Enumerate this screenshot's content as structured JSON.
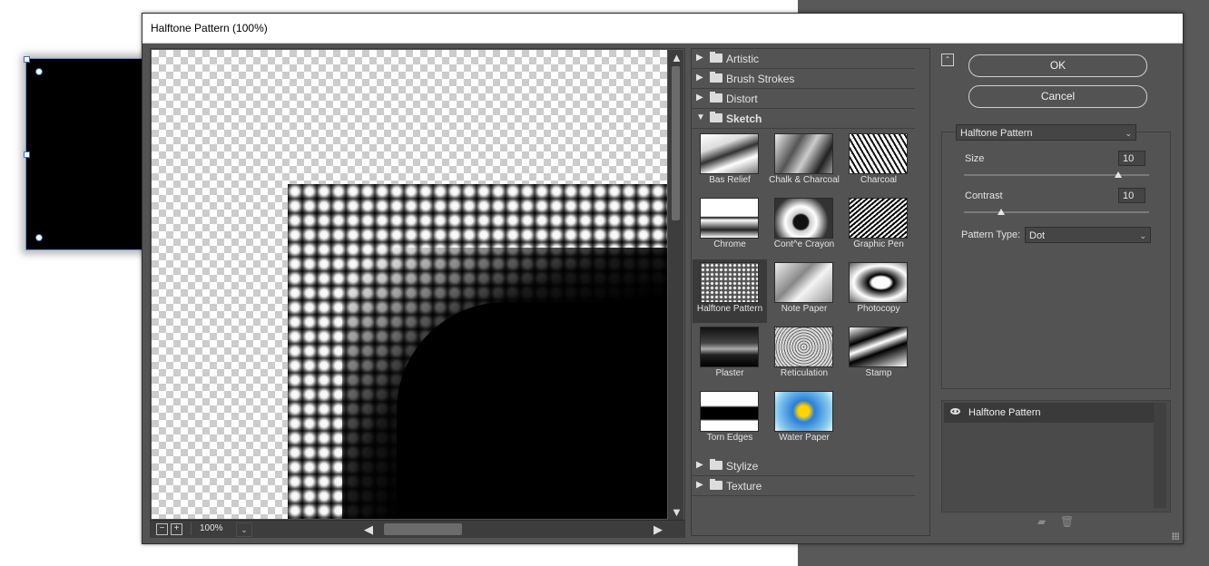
{
  "window": {
    "title": "Halftone Pattern (100%)"
  },
  "preview": {
    "zoom": "100%",
    "zoom_out": "−",
    "zoom_in": "+"
  },
  "gallery": {
    "categories_top": [
      {
        "label": "Artistic",
        "open": false
      },
      {
        "label": "Brush Strokes",
        "open": false
      },
      {
        "label": "Distort",
        "open": false
      },
      {
        "label": "Sketch",
        "open": true
      }
    ],
    "filters": [
      {
        "label": "Bas Relief",
        "style": "t-bw1"
      },
      {
        "label": "Chalk & Charcoal",
        "style": "t-bw2"
      },
      {
        "label": "Charcoal",
        "style": "t-bw3"
      },
      {
        "label": "Chrome",
        "style": "t-bw4"
      },
      {
        "label": "Cont^e Crayon",
        "style": "t-bw5"
      },
      {
        "label": "Graphic Pen",
        "style": "t-bw6"
      },
      {
        "label": "Halftone Pattern",
        "style": "t-ht",
        "selected": true
      },
      {
        "label": "Note Paper",
        "style": "t-np"
      },
      {
        "label": "Photocopy",
        "style": "t-pc"
      },
      {
        "label": "Plaster",
        "style": "t-pl"
      },
      {
        "label": "Reticulation",
        "style": "t-rt"
      },
      {
        "label": "Stamp",
        "style": "t-st"
      },
      {
        "label": "Torn Edges",
        "style": "t-te"
      },
      {
        "label": "Water Paper",
        "style": "t-wp"
      }
    ],
    "categories_bottom": [
      {
        "label": "Stylize",
        "open": false
      },
      {
        "label": "Texture",
        "open": false
      }
    ]
  },
  "buttons": {
    "ok": "OK",
    "cancel": "Cancel"
  },
  "settings": {
    "filter_select": "Halftone Pattern",
    "size_label": "Size",
    "size_value": "10",
    "size_max": 12,
    "contrast_label": "Contrast",
    "contrast_value": "10",
    "contrast_max": 50,
    "pattern_type_label": "Pattern Type:",
    "pattern_type_value": "Dot"
  },
  "layers": {
    "items": [
      {
        "name": "Halftone Pattern",
        "visible": true
      }
    ]
  },
  "icons": {
    "collapse": "collapse-up-icon",
    "new_layer": "new-effect-layer-icon",
    "delete": "trash-icon",
    "eye": "eye-icon",
    "folder": "folder-icon"
  }
}
